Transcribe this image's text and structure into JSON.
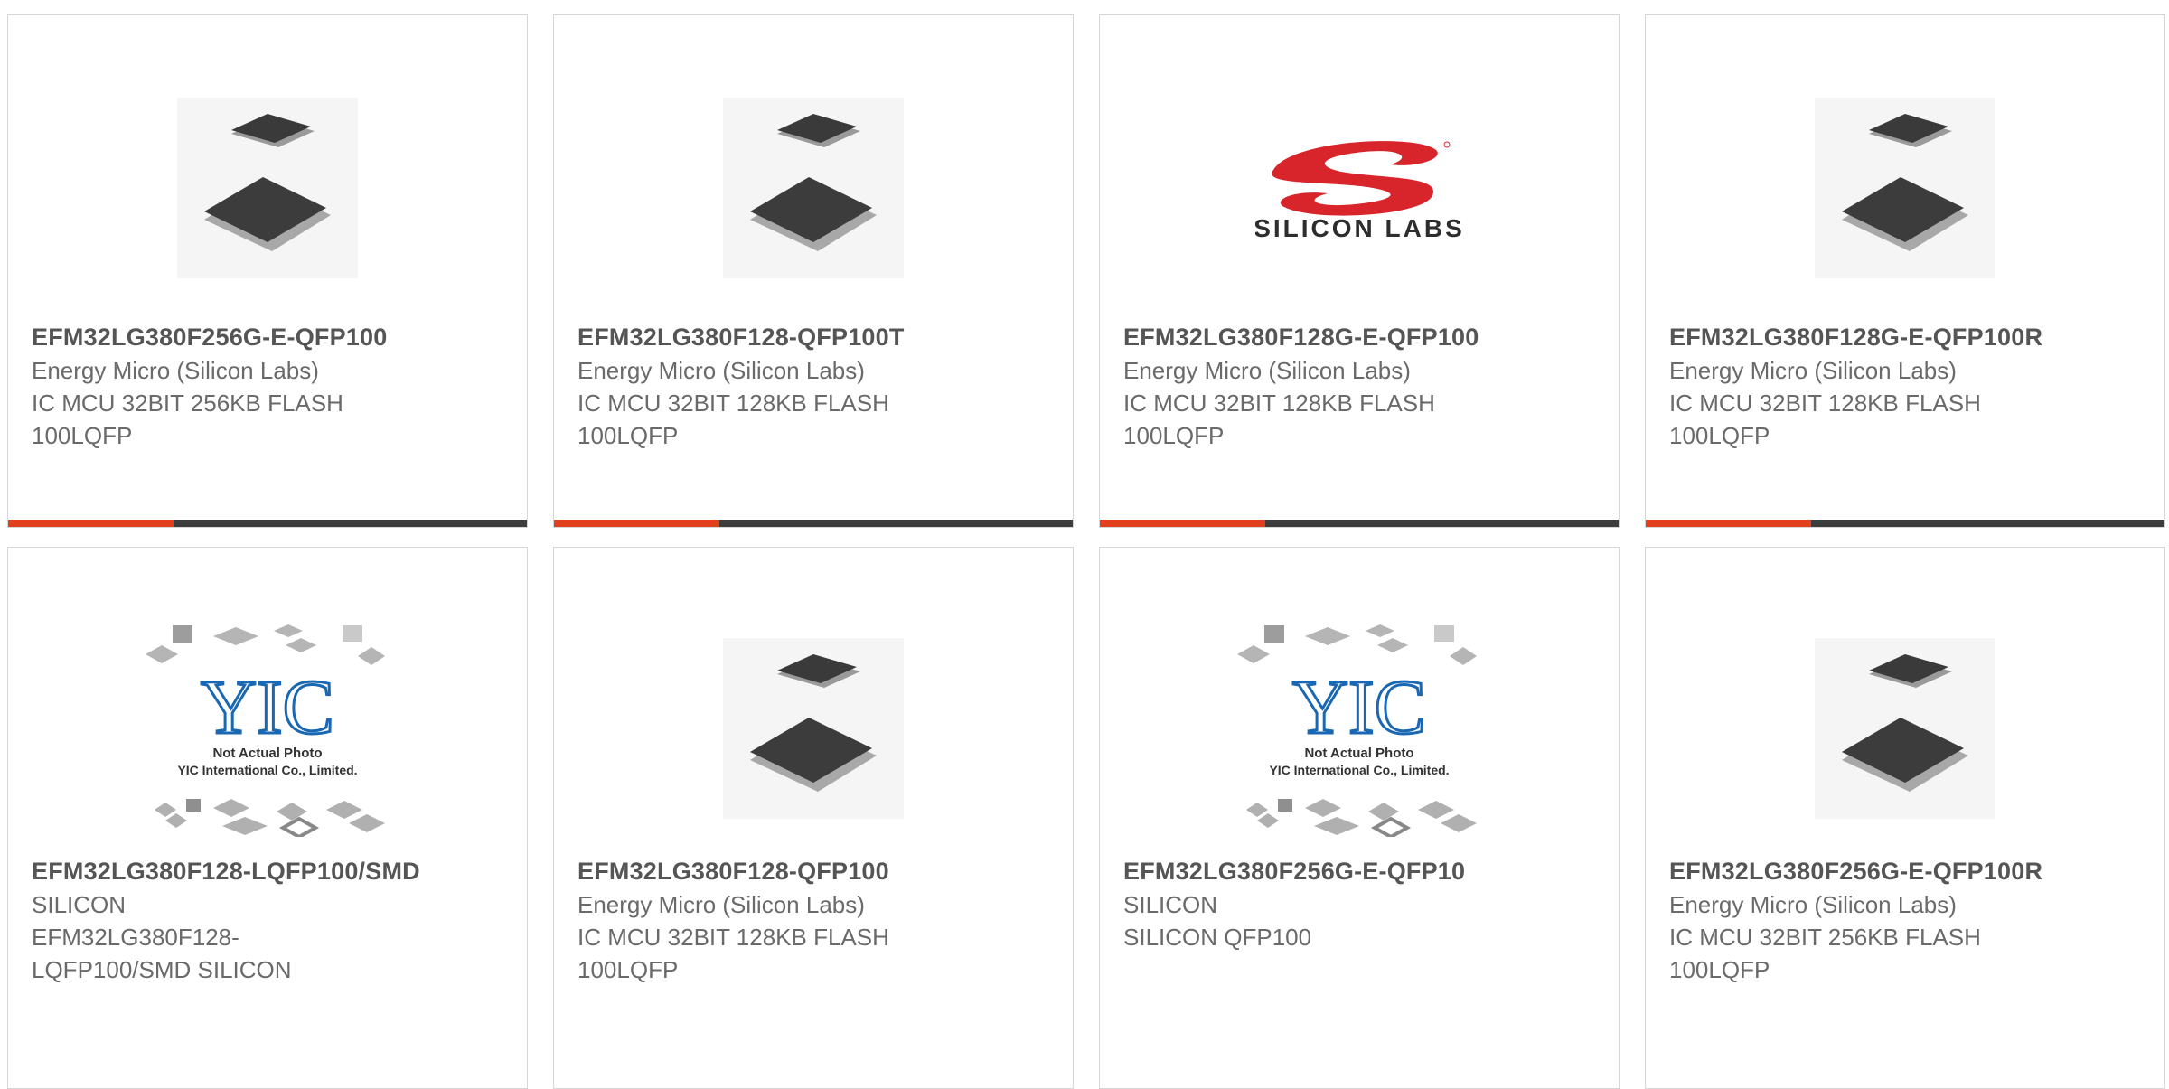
{
  "products": [
    {
      "part_number": "EFM32LG380F256G-E-QFP100",
      "manufacturer": "Energy Micro (Silicon Labs)",
      "description": "IC MCU 32BIT 256KB FLASH\n100LQFP",
      "image": "chip-photo"
    },
    {
      "part_number": "EFM32LG380F128-QFP100T",
      "manufacturer": "Energy Micro (Silicon Labs)",
      "description": "IC MCU 32BIT 128KB FLASH\n100LQFP",
      "image": "chip-photo"
    },
    {
      "part_number": "EFM32LG380F128G-E-QFP100",
      "manufacturer": "Energy Micro (Silicon Labs)",
      "description": "IC MCU 32BIT 128KB FLASH\n100LQFP",
      "image": "silicon-labs-logo",
      "logo_text": "SILICON LABS"
    },
    {
      "part_number": "EFM32LG380F128G-E-QFP100R",
      "manufacturer": "Energy Micro (Silicon Labs)",
      "description": "IC MCU 32BIT 128KB FLASH\n100LQFP",
      "image": "chip-photo"
    },
    {
      "part_number": "EFM32LG380F128-LQFP100/SMD",
      "manufacturer": "SILICON",
      "description": "EFM32LG380F128-\nLQFP100/SMD SILICON",
      "image": "yic-placeholder",
      "placeholder_line1": "Not Actual Photo",
      "placeholder_line2": "YIC International Co., Limited."
    },
    {
      "part_number": "EFM32LG380F128-QFP100",
      "manufacturer": "Energy Micro (Silicon Labs)",
      "description": "IC MCU 32BIT 128KB FLASH\n100LQFP",
      "image": "chip-photo"
    },
    {
      "part_number": "EFM32LG380F256G-E-QFP10",
      "manufacturer": "SILICON",
      "description": "SILICON QFP100",
      "image": "yic-placeholder",
      "placeholder_line1": "Not Actual Photo",
      "placeholder_line2": "YIC International Co., Limited."
    },
    {
      "part_number": "EFM32LG380F256G-E-QFP100R",
      "manufacturer": "Energy Micro (Silicon Labs)",
      "description": "IC MCU 32BIT 256KB FLASH\n100LQFP",
      "image": "chip-photo"
    }
  ],
  "colors": {
    "accent": "#e0401c",
    "bar": "#3d3d3d",
    "part_number": "#555555",
    "text": "#6a6a6a",
    "border": "#d6d6d6",
    "logo_red": "#d8252b"
  }
}
